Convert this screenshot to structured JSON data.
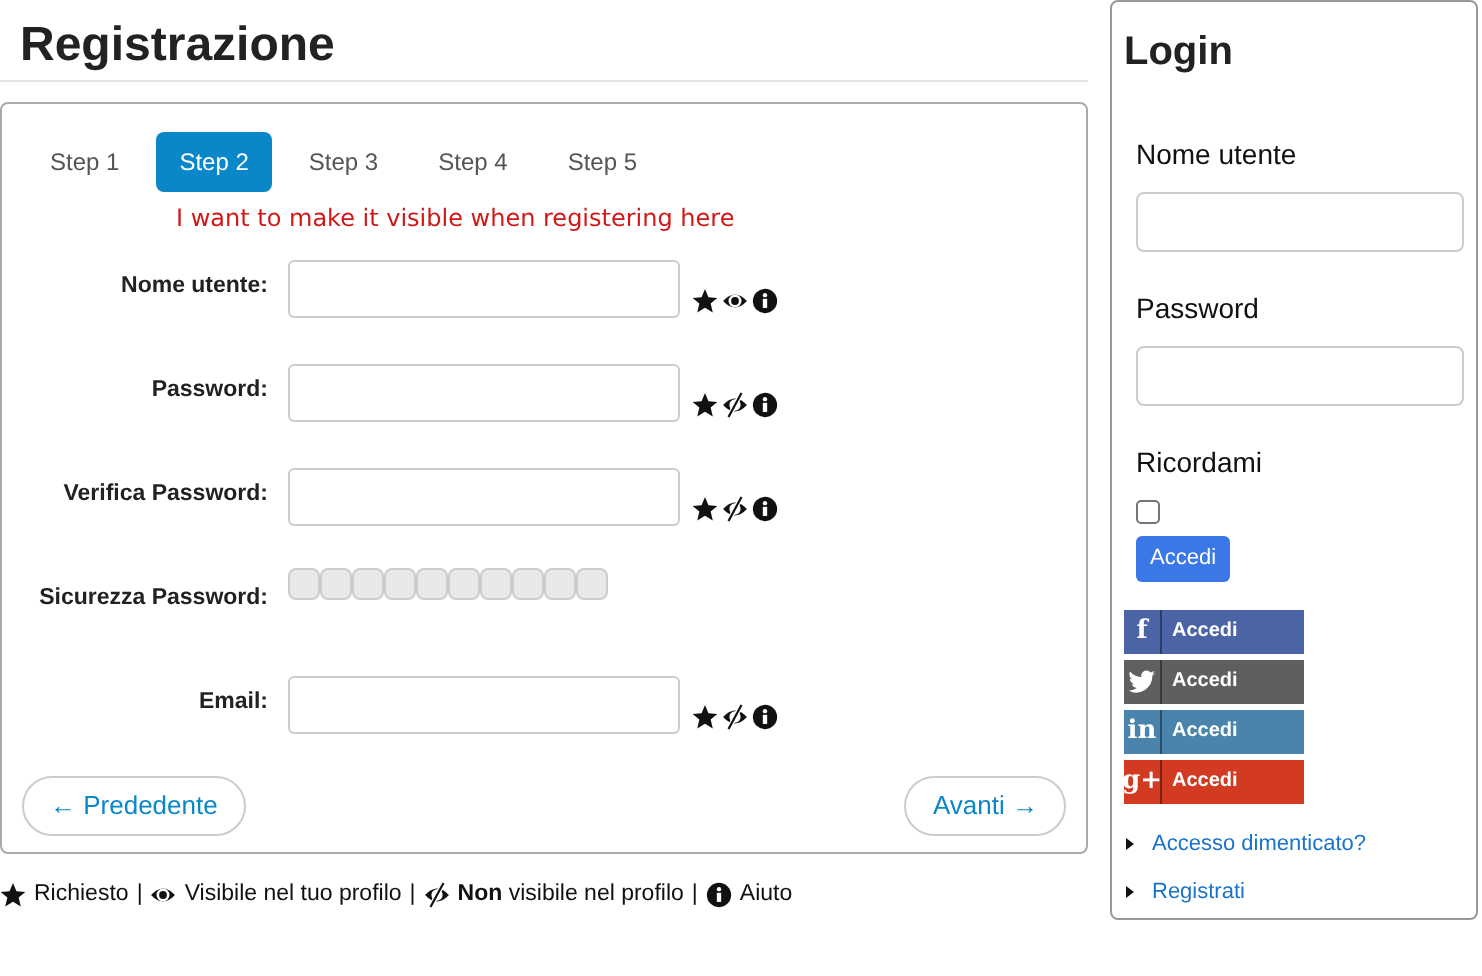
{
  "page_title": "Registrazione",
  "tabs": [
    {
      "label": "Step 1",
      "selected": false
    },
    {
      "label": "Step 2",
      "selected": true
    },
    {
      "label": "Step 3",
      "selected": false
    },
    {
      "label": "Step 4",
      "selected": false
    },
    {
      "label": "Step 5",
      "selected": false
    }
  ],
  "note": "I want to make it visible when registering here",
  "fields": [
    {
      "kind": "input",
      "label": "Nome utente:",
      "icons": [
        {
          "kind": "required"
        },
        {
          "kind": "visible"
        },
        {
          "kind": "help"
        }
      ]
    },
    {
      "kind": "input",
      "label": "Password:",
      "icons": [
        {
          "kind": "required"
        },
        {
          "kind": "hidden"
        },
        {
          "kind": "help"
        }
      ]
    },
    {
      "kind": "input",
      "label": "Verifica Password:",
      "icons": [
        {
          "kind": "required"
        },
        {
          "kind": "hidden"
        },
        {
          "kind": "help"
        }
      ]
    },
    {
      "kind": "meter",
      "label": "Sicurezza Password:"
    },
    {
      "kind": "input",
      "label": "Email:",
      "icons": [
        {
          "kind": "required"
        },
        {
          "kind": "hidden"
        },
        {
          "kind": "help"
        }
      ]
    }
  ],
  "prev_button": {
    "arrow": "←",
    "label": "Prededente"
  },
  "next_button": {
    "label": "Avanti",
    "arrow": "→"
  },
  "legend": [
    {
      "kind": "required",
      "text": "Richiesto"
    },
    {
      "separator": "|"
    },
    {
      "kind": "visible",
      "text": "Visibile nel tuo profilo"
    },
    {
      "separator": "|"
    },
    {
      "kind": "hidden",
      "text": "**Non** visibile nel profilo"
    },
    {
      "separator": "|"
    },
    {
      "kind": "help",
      "text": "Aiuto"
    }
  ],
  "login": {
    "title": "Login",
    "username_label": "Nome utente",
    "password_label": "Password",
    "remember_label": "Ricordami",
    "remember_checked": false,
    "submit": "Accedi",
    "social": [
      {
        "kind": "letter",
        "logo": "f",
        "label": "Accedi",
        "color": "#4a64a6"
      },
      {
        "kind": "bird",
        "label": "Accedi",
        "color": "#5f5f5f"
      },
      {
        "kind": "letter",
        "logo": "in",
        "label": "Accedi",
        "color": "#4a84ad"
      },
      {
        "kind": "letter",
        "logo": "g+",
        "label": "Accedi",
        "color": "#d23a22"
      }
    ],
    "links": [
      "Accesso dimenticato?",
      "Registrati"
    ]
  }
}
